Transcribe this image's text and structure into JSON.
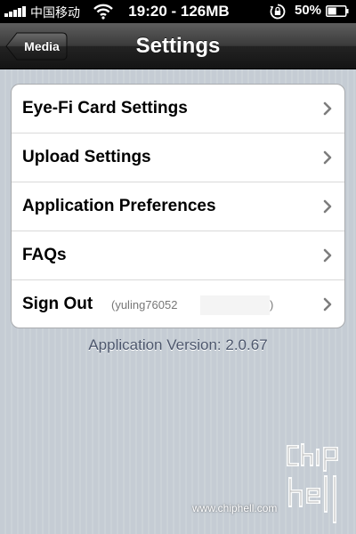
{
  "status_bar": {
    "carrier": "中国移动",
    "time": "19:20 - 126MB",
    "battery": "50%",
    "battery_level": 0.5,
    "icons": [
      "signal-bars-icon",
      "wifi-icon",
      "rotation-lock-icon",
      "battery-icon"
    ]
  },
  "nav": {
    "back_label": "Media",
    "title": "Settings"
  },
  "settings_rows": [
    {
      "label": "Eye-Fi Card Settings",
      "icon": "chevron-right-icon"
    },
    {
      "label": "Upload Settings",
      "icon": "chevron-right-icon"
    },
    {
      "label": "Application Preferences",
      "icon": "chevron-right-icon"
    },
    {
      "label": "FAQs",
      "icon": "chevron-right-icon"
    },
    {
      "label": "Sign Out",
      "account_open": "(yuling76052",
      "account_close": ")",
      "icon": "chevron-right-icon"
    }
  ],
  "footer": {
    "version": "Application Version: 2.0.67"
  },
  "watermark": {
    "url": "www.chiphell.com",
    "logo_text": "chiphell"
  },
  "colors": {
    "background": "#c5ccd4",
    "nav_bar": "#2b2b2b",
    "version_text": "#4c566c"
  }
}
